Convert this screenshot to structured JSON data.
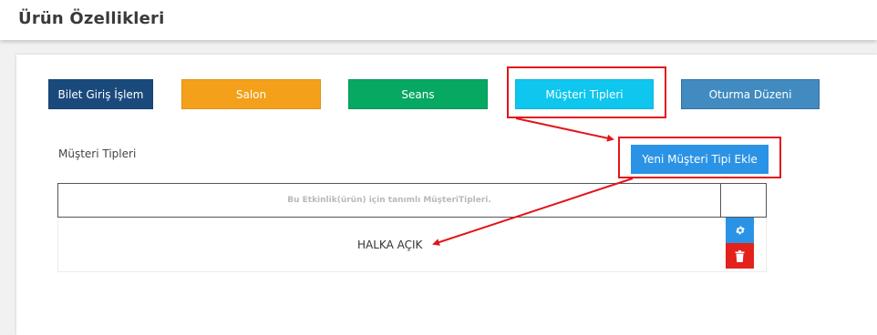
{
  "page": {
    "title": "Ürün Özellikleri"
  },
  "nav": {
    "bilet": "Bilet Giriş İşlem",
    "salon": "Salon",
    "seans": "Seans",
    "musteri": "Müşteri Tipleri",
    "oturma": "Oturma Düzeni"
  },
  "section": {
    "label": "Müşteri Tipleri",
    "add_button": "Yeni Müşteri Tipi Ekle"
  },
  "table": {
    "header_text": "Bu Etkinlik(ürün) için tanımlı MüşteriTipleri.",
    "rows": [
      {
        "name": "HALKA AÇIK"
      }
    ]
  },
  "icons": {
    "edit": "gear-icon",
    "delete": "trash-icon"
  },
  "colors": {
    "bilet": "#1a4a7c",
    "salon": "#f4a01a",
    "seans": "#06a862",
    "musteri": "#0ec6ee",
    "oturma": "#418bc1",
    "add": "#2b93e6",
    "delete": "#e3231b",
    "annotation": "#e3151a"
  }
}
